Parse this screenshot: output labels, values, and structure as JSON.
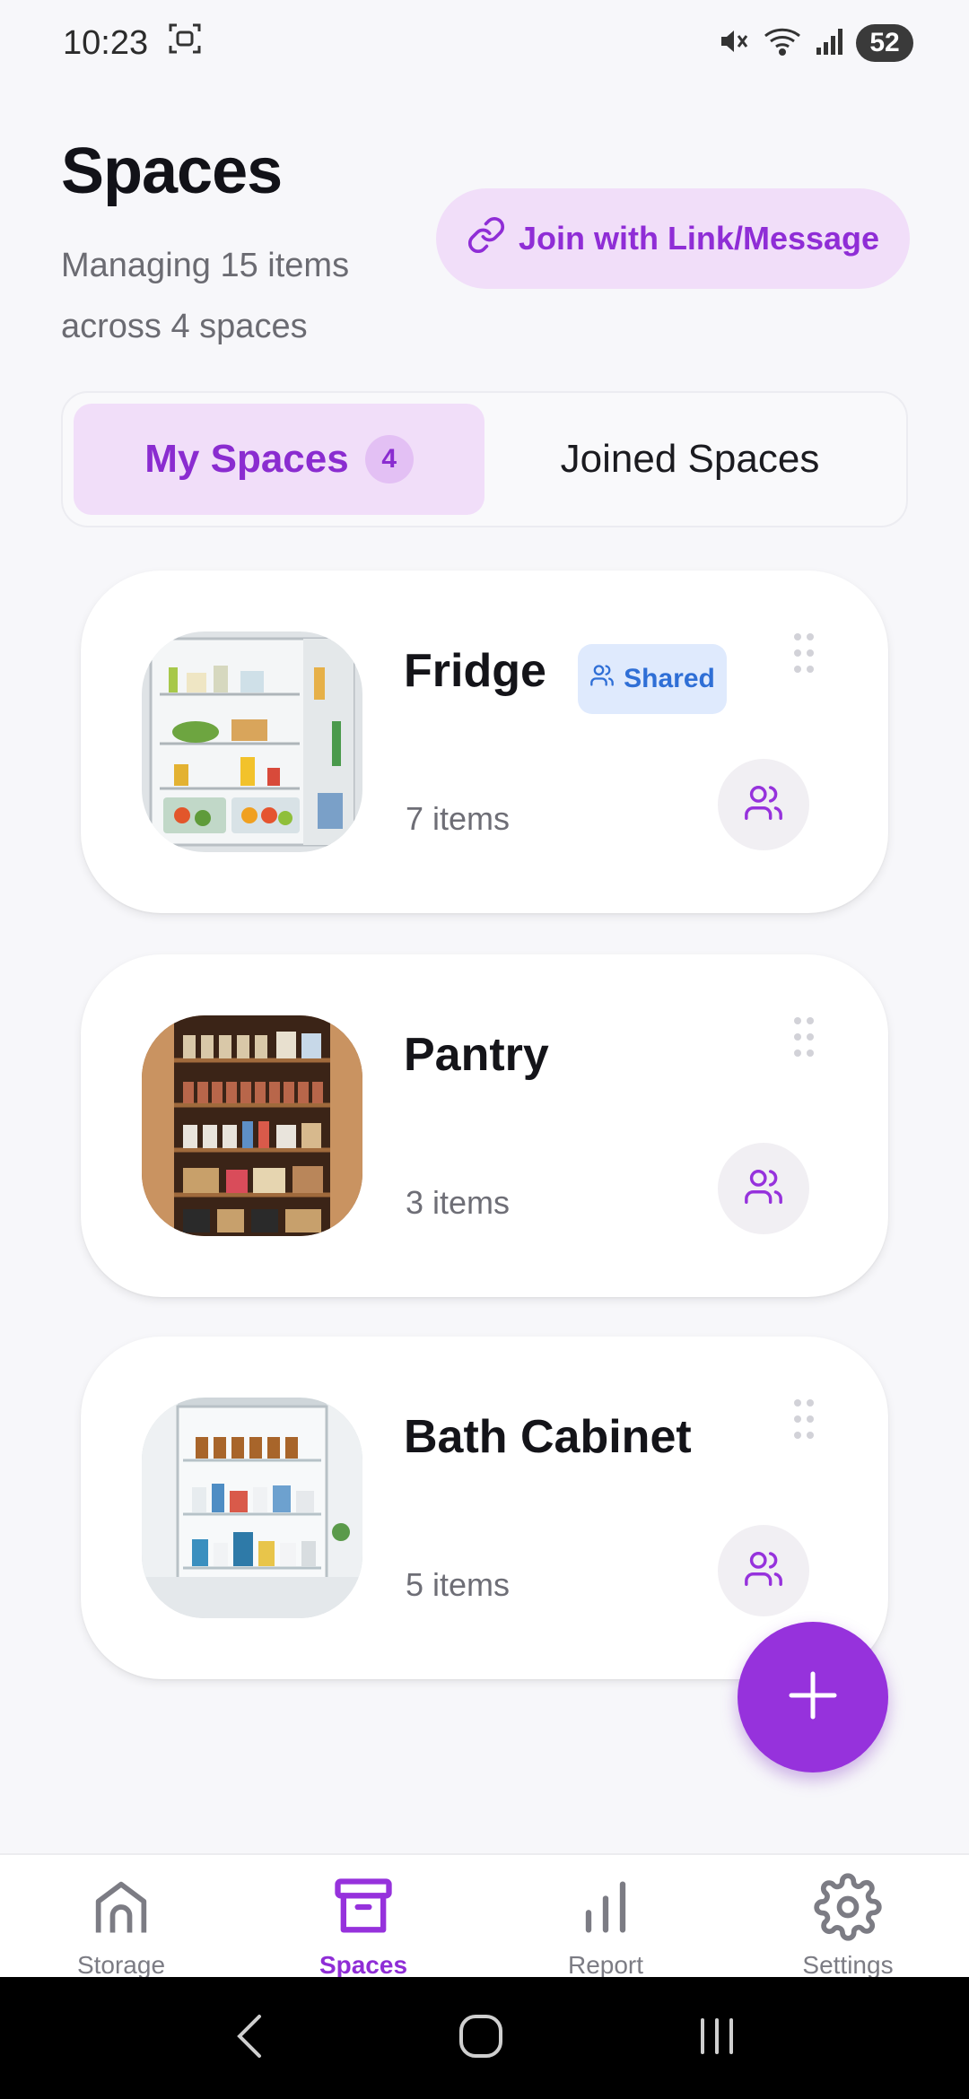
{
  "status_bar": {
    "time": "10:23",
    "battery": "52",
    "icons": [
      "screenshot-icon",
      "mute-icon",
      "wifi-icon",
      "signal-icon"
    ]
  },
  "header": {
    "title": "Spaces",
    "subtitle": "Managing 15 items across 4 spaces",
    "join_button_label": "Join with Link/Message"
  },
  "tabs": [
    {
      "label": "My Spaces",
      "badge": "4",
      "active": true
    },
    {
      "label": "Joined Spaces",
      "active": false
    }
  ],
  "spaces": [
    {
      "name": "Fridge",
      "count": "7 items",
      "badge": "Shared",
      "image": "fridge"
    },
    {
      "name": "Pantry",
      "count": "3 items",
      "image": "pantry"
    },
    {
      "name": "Bath Cabinet",
      "count": "5 items",
      "image": "bath-cabinet"
    }
  ],
  "bottom_nav": [
    {
      "label": "Storage",
      "icon": "home-icon",
      "active": false
    },
    {
      "label": "Spaces",
      "icon": "archive-box-icon",
      "active": true
    },
    {
      "label": "Report",
      "icon": "bar-chart-icon",
      "active": false
    },
    {
      "label": "Settings",
      "icon": "gear-icon",
      "active": false
    }
  ],
  "colors": {
    "accent": "#9632dc",
    "accent_light": "#f1def9",
    "shared_badge_bg": "#dfeafd",
    "shared_badge_text": "#2f6fd6"
  }
}
